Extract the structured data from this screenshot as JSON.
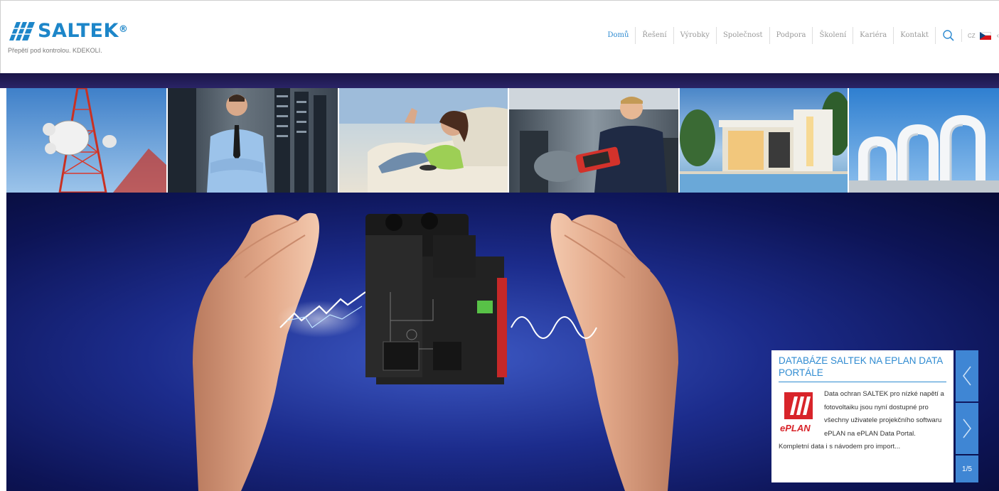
{
  "brand": {
    "name": "SALTEK",
    "registered": "®",
    "tagline": "Přepětí pod kontrolou. KDEKOLI.",
    "color": "#1d86c9"
  },
  "nav": {
    "items": [
      {
        "label": "Domů",
        "active": true
      },
      {
        "label": "Řešení",
        "active": false
      },
      {
        "label": "Výrobky",
        "active": false
      },
      {
        "label": "Společnost",
        "active": false
      },
      {
        "label": "Podpora",
        "active": false
      },
      {
        "label": "Školení",
        "active": false
      },
      {
        "label": "Kariéra",
        "active": false
      },
      {
        "label": "Kontakt",
        "active": false
      }
    ],
    "search_icon": "search-icon",
    "language": "CZ",
    "flag_icon": "czech-flag-icon",
    "more_label": "‹"
  },
  "photo_strip": [
    "telecom-tower",
    "server-room-technician",
    "woman-on-sofa",
    "car-mechanic",
    "modern-house",
    "industrial-pipes"
  ],
  "hero": {
    "product_label": "surge-protection-device",
    "accent_color": "#2f8bd1"
  },
  "news": {
    "title": "DATABÁZE SALTEK NA EPLAN DATA PORTÁLE",
    "body": "Data ochran SALTEK pro nízké napětí a fotovoltaiku jsou nyní dostupné pro všechny uživatele projekčního softwaru ePLAN na ePLAN Data Portal. Kompletní data i s návodem pro import...",
    "logo_text": "ePLAN",
    "counter": "1/5",
    "prev_icon": "chevron-left-icon",
    "next_icon": "chevron-right-icon"
  }
}
